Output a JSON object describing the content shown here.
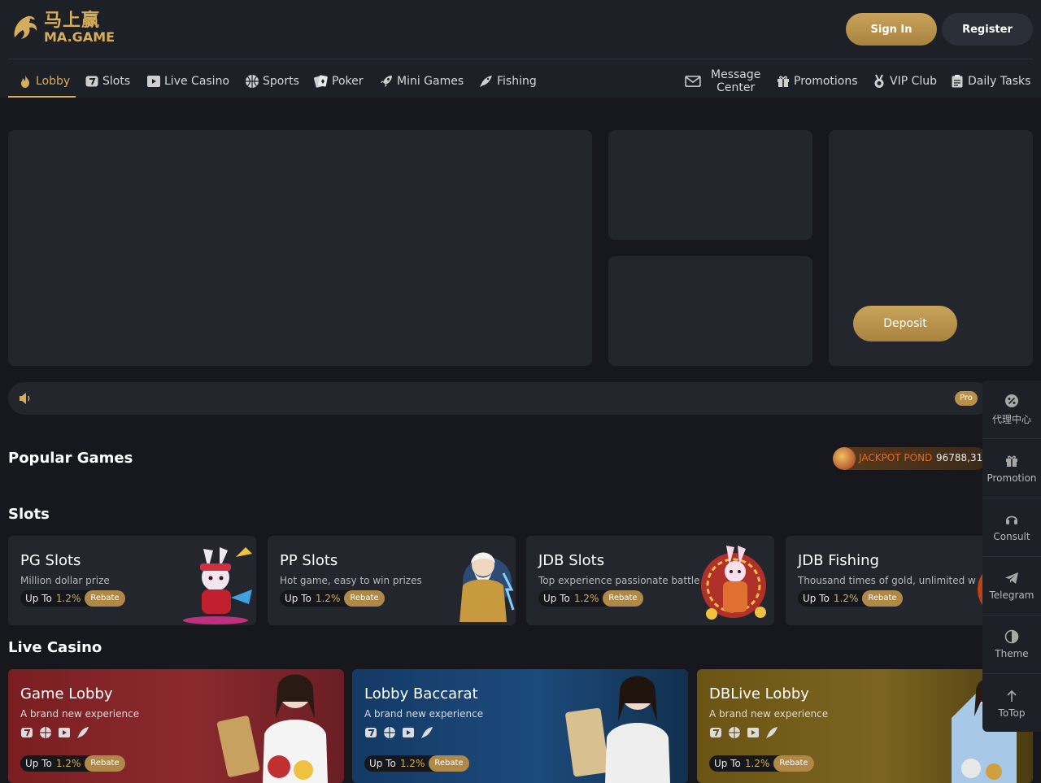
{
  "brand": {
    "logo_cn": "马上赢",
    "logo_en": "MA.GAME"
  },
  "header": {
    "signin_label": "Sign In",
    "register_label": "Register"
  },
  "nav": {
    "lobby": "Lobby",
    "slots": "Slots",
    "live_casino": "Live Casino",
    "sports": "Sports",
    "poker": "Poker",
    "mini_games": "Mini Games",
    "fishing": "Fishing",
    "message_center_line1": "Message",
    "message_center_line2": "Center",
    "promotions": "Promotions",
    "vip_club": "VIP Club",
    "daily_tasks": "Daily Tasks"
  },
  "banner": {
    "deposit_label": "Deposit"
  },
  "notice": {
    "pill_text": "Pro"
  },
  "popular": {
    "title": "Popular Games",
    "jackpot_label": "JACKPOT POND",
    "jackpot_value": "96788,31"
  },
  "slots": {
    "title": "Slots",
    "cards": [
      {
        "title": "PG Slots",
        "subtitle": "Million dollar prize",
        "upto": "Up To",
        "pct": "1.2%",
        "rebate": "Rebate"
      },
      {
        "title": "PP Slots",
        "subtitle": "Hot game, easy to win prizes",
        "upto": "Up To",
        "pct": "1.2%",
        "rebate": "Rebate"
      },
      {
        "title": "JDB Slots",
        "subtitle": "Top experience passionate battle",
        "upto": "Up To",
        "pct": "1.2%",
        "rebate": "Rebate"
      },
      {
        "title": "JDB Fishing",
        "subtitle": "Thousand times of gold, unlimited w",
        "upto": "Up To",
        "pct": "1.2%",
        "rebate": "Rebate"
      }
    ]
  },
  "live_casino": {
    "title": "Live Casino",
    "cards": [
      {
        "title": "Game Lobby",
        "subtitle": "A brand new experience",
        "upto": "Up To",
        "pct": "1.2%",
        "rebate": "Rebate",
        "color": "#7a1e22"
      },
      {
        "title": "Lobby Baccarat",
        "subtitle": "A brand new experience",
        "upto": "Up To",
        "pct": "1.2%",
        "rebate": "Rebate",
        "color": "#143a66"
      },
      {
        "title": "DBLive Lobby",
        "subtitle": "A brand new experience",
        "upto": "Up To",
        "pct": "1.2%",
        "rebate": "Rebate",
        "color": "#6b5414"
      }
    ]
  },
  "sidebar": {
    "agent": "代理中心",
    "promotion": "Promotion",
    "consult": "Consult",
    "telegram": "Telegram",
    "theme": "Theme",
    "totop": "ToTop"
  },
  "colors": {
    "accent_gold": "#d6ad5c",
    "page_bg": "#16181d",
    "panel_bg": "#23262d"
  }
}
